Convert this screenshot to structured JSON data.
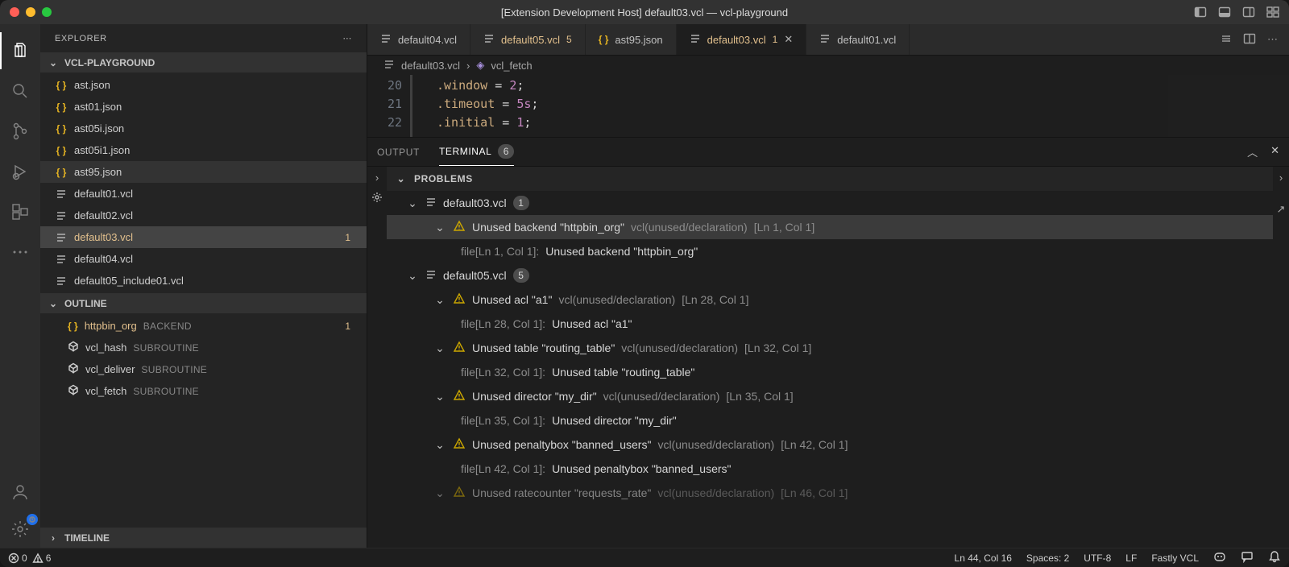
{
  "titlebar": {
    "title": "[Extension Development Host] default03.vcl — vcl-playground"
  },
  "sidebar": {
    "header": "EXPLORER",
    "project": "VCL-PLAYGROUND",
    "files": [
      {
        "name": "ast.json",
        "kind": "json"
      },
      {
        "name": "ast01.json",
        "kind": "json"
      },
      {
        "name": "ast05i.json",
        "kind": "json"
      },
      {
        "name": "ast05i1.json",
        "kind": "json"
      },
      {
        "name": "ast95.json",
        "kind": "json",
        "highlight": true
      },
      {
        "name": "default01.vcl",
        "kind": "lines"
      },
      {
        "name": "default02.vcl",
        "kind": "lines"
      },
      {
        "name": "default03.vcl",
        "kind": "lines",
        "active": true,
        "badge": "1"
      },
      {
        "name": "default04.vcl",
        "kind": "lines"
      },
      {
        "name": "default05_include01.vcl",
        "kind": "lines"
      }
    ],
    "outline_header": "OUTLINE",
    "outline": [
      {
        "sym": "{}",
        "name": "httpbin_org",
        "tag": "BACKEND",
        "hl": true,
        "badge": "1"
      },
      {
        "sym": "◇",
        "name": "vcl_hash",
        "tag": "SUBROUTINE"
      },
      {
        "sym": "◇",
        "name": "vcl_deliver",
        "tag": "SUBROUTINE"
      },
      {
        "sym": "◇",
        "name": "vcl_fetch",
        "tag": "SUBROUTINE"
      }
    ],
    "timeline_header": "TIMELINE"
  },
  "tabs": [
    {
      "name": "default04.vcl",
      "icon": "lines"
    },
    {
      "name": "default05.vcl",
      "icon": "lines",
      "modified": true,
      "badge": "5"
    },
    {
      "name": "ast95.json",
      "icon": "json"
    },
    {
      "name": "default03.vcl",
      "icon": "lines",
      "modified": true,
      "badge": "1",
      "active": true,
      "close": true
    },
    {
      "name": "default01.vcl",
      "icon": "lines"
    }
  ],
  "breadcrumb": {
    "file": "default03.vcl",
    "symbol": "vcl_fetch"
  },
  "editor": {
    "lines": [
      {
        "n": "20",
        "prop": ".window",
        "val": "2",
        "suffix": ";"
      },
      {
        "n": "21",
        "prop": ".timeout",
        "val": "5s",
        "suffix": ";"
      },
      {
        "n": "22",
        "prop": ".initial",
        "val": "1",
        "suffix": ";"
      }
    ]
  },
  "panel": {
    "tabs": {
      "output": "OUTPUT",
      "terminal": "TERMINAL",
      "terminal_badge": "6",
      "problems": "PROBLEMS"
    },
    "problems": [
      {
        "type": "file",
        "name": "default03.vcl",
        "count": "1"
      },
      {
        "type": "warn",
        "msg": "Unused backend \"httpbin_org\"",
        "meta": "vcl(unused/declaration)",
        "loc": "[Ln 1, Col 1]",
        "selected": true
      },
      {
        "type": "detail",
        "pre": "file[Ln 1, Col 1]: ",
        "msg": "Unused backend \"httpbin_org\""
      },
      {
        "type": "file",
        "name": "default05.vcl",
        "count": "5"
      },
      {
        "type": "warn",
        "msg": "Unused acl \"a1\"",
        "meta": "vcl(unused/declaration)",
        "loc": "[Ln 28, Col 1]"
      },
      {
        "type": "detail",
        "pre": "file[Ln 28, Col 1]: ",
        "msg": "Unused acl \"a1\""
      },
      {
        "type": "warn",
        "msg": "Unused table \"routing_table\"",
        "meta": "vcl(unused/declaration)",
        "loc": "[Ln 32, Col 1]"
      },
      {
        "type": "detail",
        "pre": "file[Ln 32, Col 1]: ",
        "msg": "Unused table \"routing_table\""
      },
      {
        "type": "warn",
        "msg": "Unused director \"my_dir\"",
        "meta": "vcl(unused/declaration)",
        "loc": "[Ln 35, Col 1]"
      },
      {
        "type": "detail",
        "pre": "file[Ln 35, Col 1]: ",
        "msg": "Unused director \"my_dir\""
      },
      {
        "type": "warn",
        "msg": "Unused penaltybox \"banned_users\"",
        "meta": "vcl(unused/declaration)",
        "loc": "[Ln 42, Col 1]"
      },
      {
        "type": "detail",
        "pre": "file[Ln 42, Col 1]: ",
        "msg": "Unused penaltybox \"banned_users\""
      },
      {
        "type": "warn",
        "msg": "Unused ratecounter \"requests_rate\"",
        "meta": "vcl(unused/declaration)",
        "loc": "[Ln 46, Col 1]",
        "cut": true
      }
    ]
  },
  "status": {
    "errors": "0",
    "warnings": "6",
    "cursor": "Ln 44, Col 16",
    "spaces": "Spaces: 2",
    "encoding": "UTF-8",
    "eol": "LF",
    "language": "Fastly VCL"
  }
}
